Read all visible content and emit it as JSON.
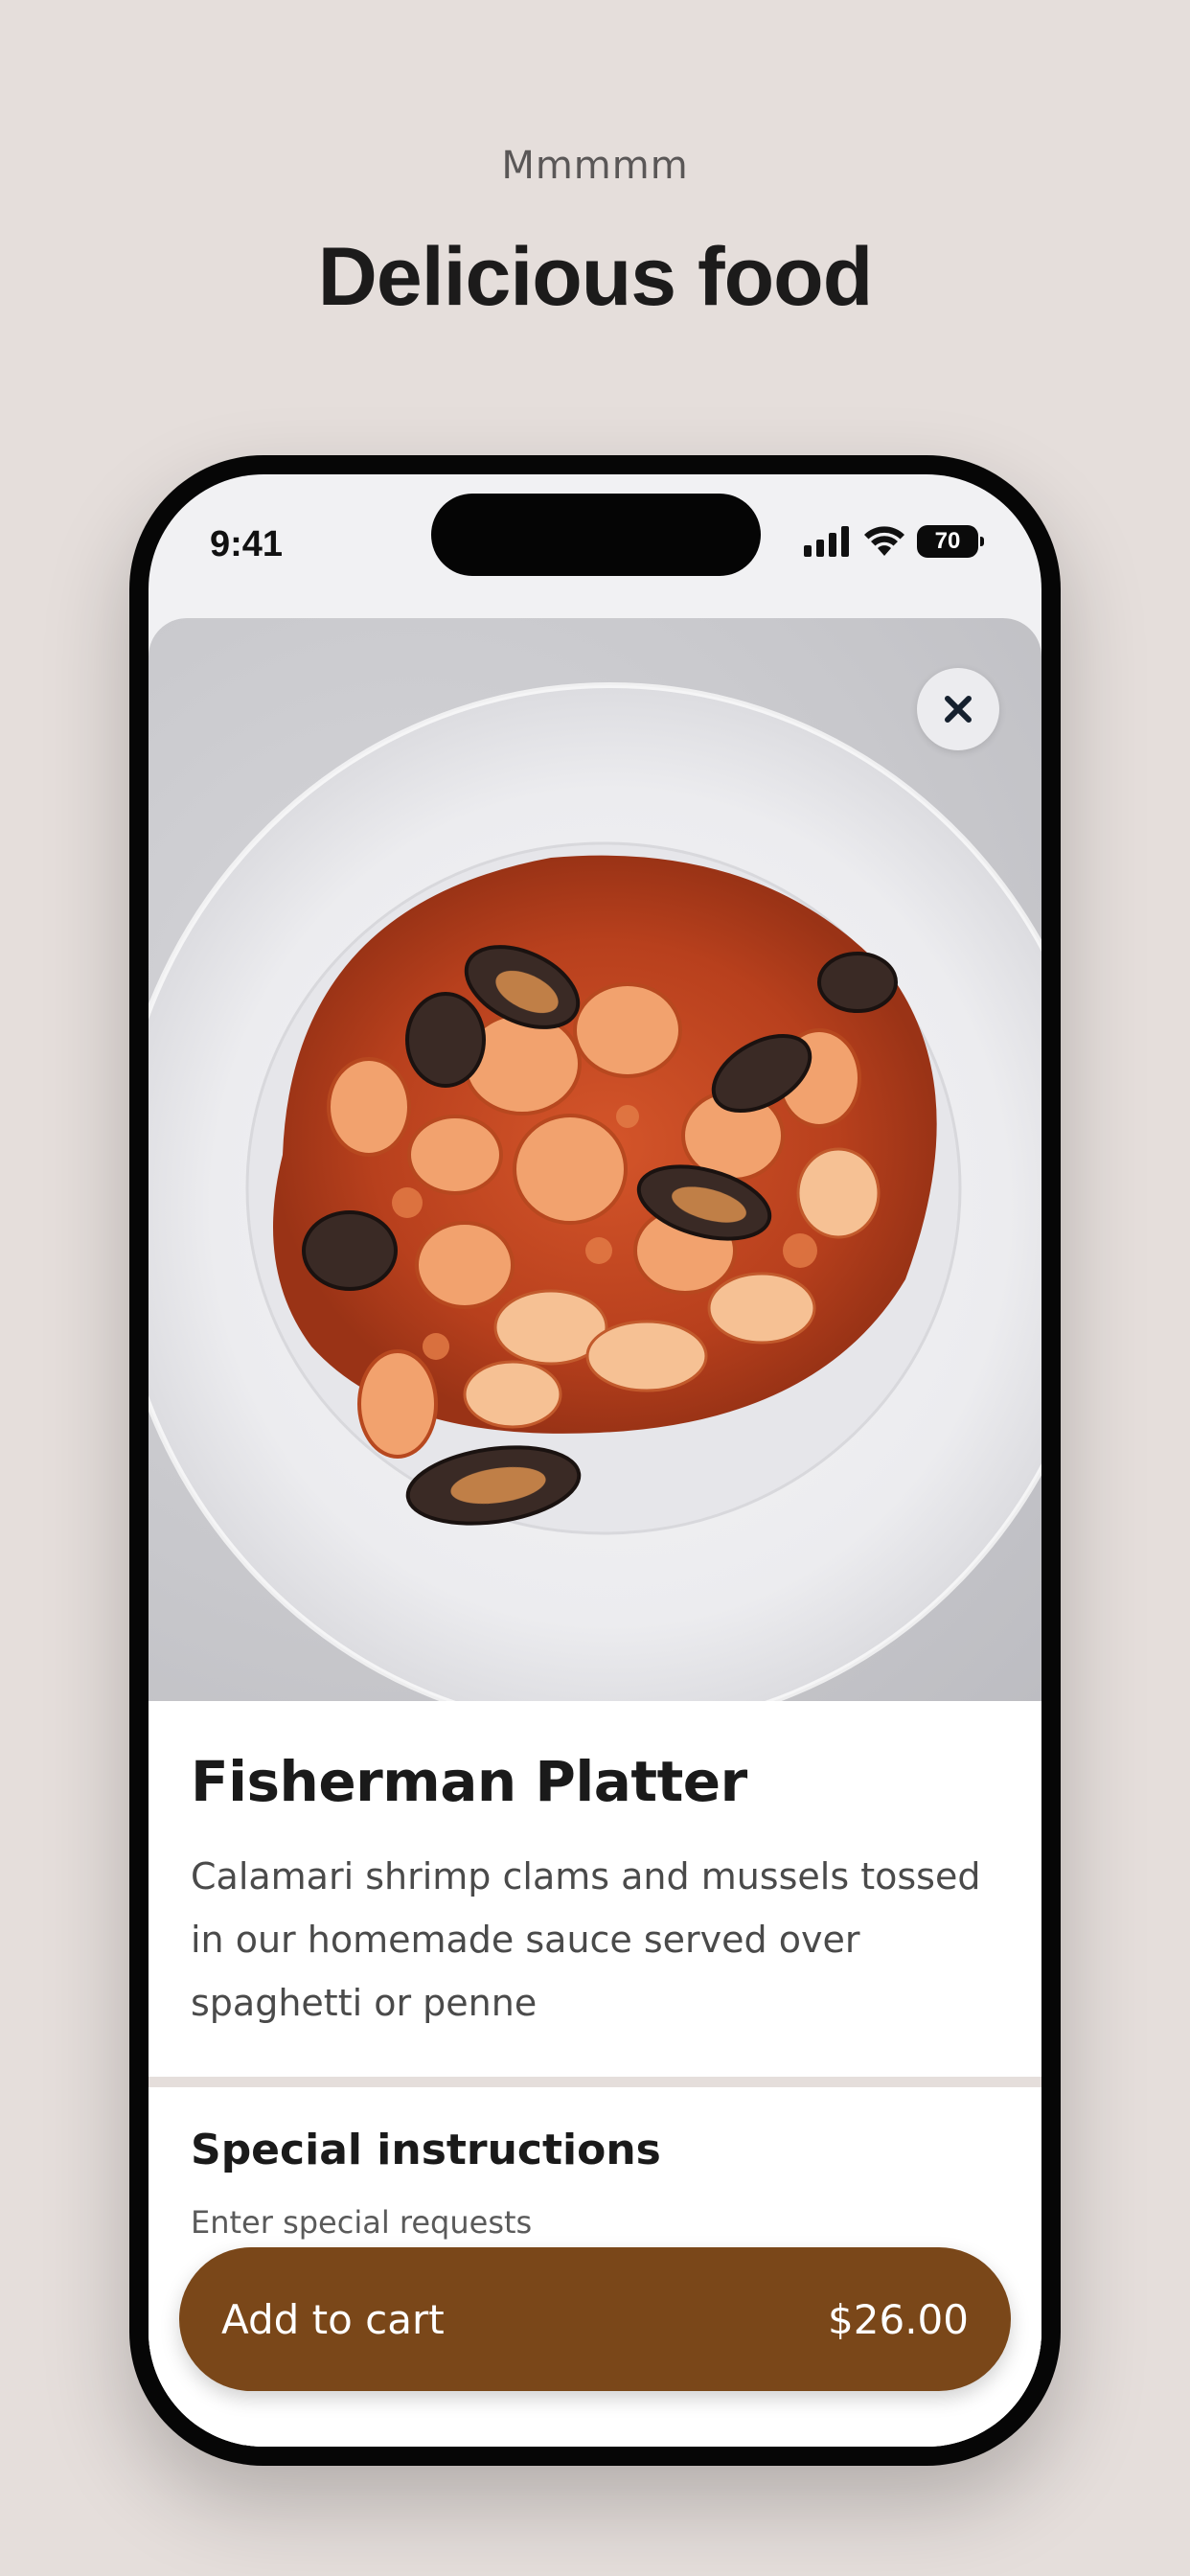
{
  "hero": {
    "eyebrow": "Mmmmm",
    "title": "Delicious food"
  },
  "status_bar": {
    "time": "9:41",
    "battery": "70"
  },
  "item": {
    "name": "Fisherman Platter",
    "description": "Calamari shrimp clams and mussels tossed in our homemade sauce served over spaghetti or penne"
  },
  "instructions": {
    "title": "Special instructions",
    "placeholder": "Enter special requests"
  },
  "cart_button": {
    "label": "Add to cart",
    "price": "$26.00"
  },
  "colors": {
    "page_background": "#e5dedb",
    "accent": "#7a4719"
  },
  "icons": {
    "close": "close-icon",
    "signal": "cellular-signal-icon",
    "wifi": "wifi-icon",
    "battery": "battery-icon"
  }
}
